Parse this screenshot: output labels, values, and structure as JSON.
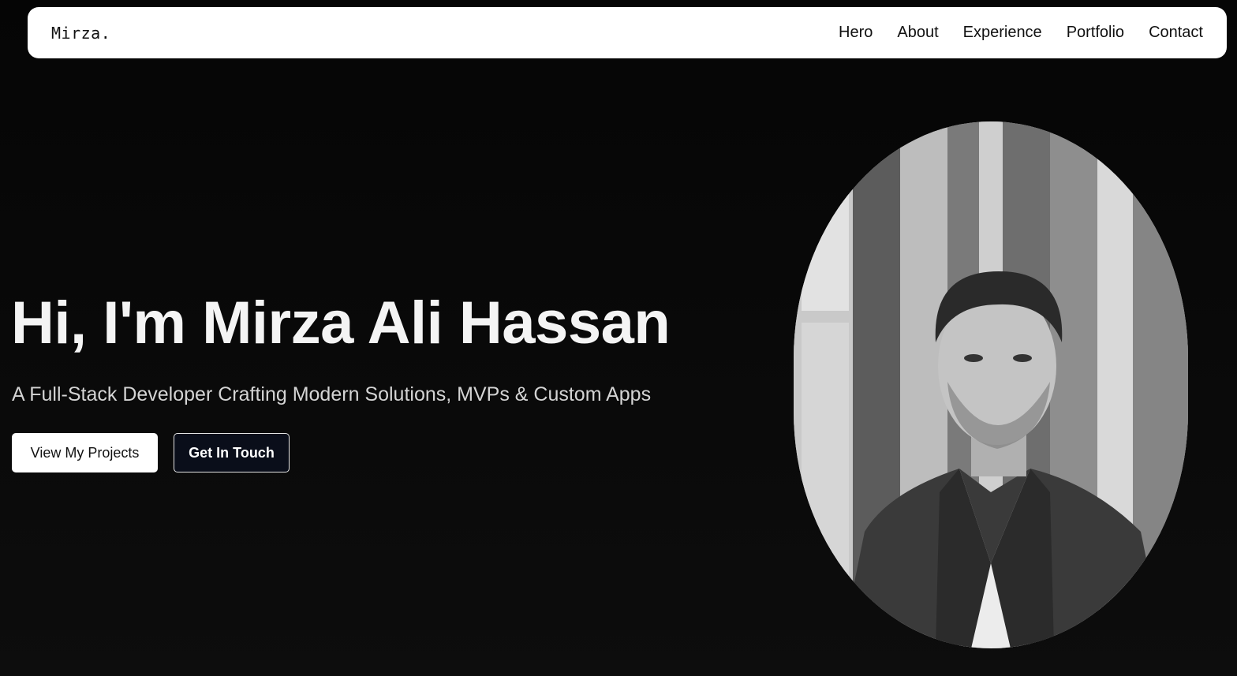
{
  "header": {
    "logo": "Mirza.",
    "nav": [
      "Hero",
      "About",
      "Experience",
      "Portfolio",
      "Contact"
    ]
  },
  "hero": {
    "title": "Hi, I'm Mirza Ali Hassan",
    "subtitle": "A Full-Stack Developer Crafting Modern Solutions, MVPs & Custom Apps",
    "primary_button": "View My Projects",
    "secondary_button": "Get In Touch"
  },
  "portrait": {
    "description_icon": "portrait-photo"
  }
}
